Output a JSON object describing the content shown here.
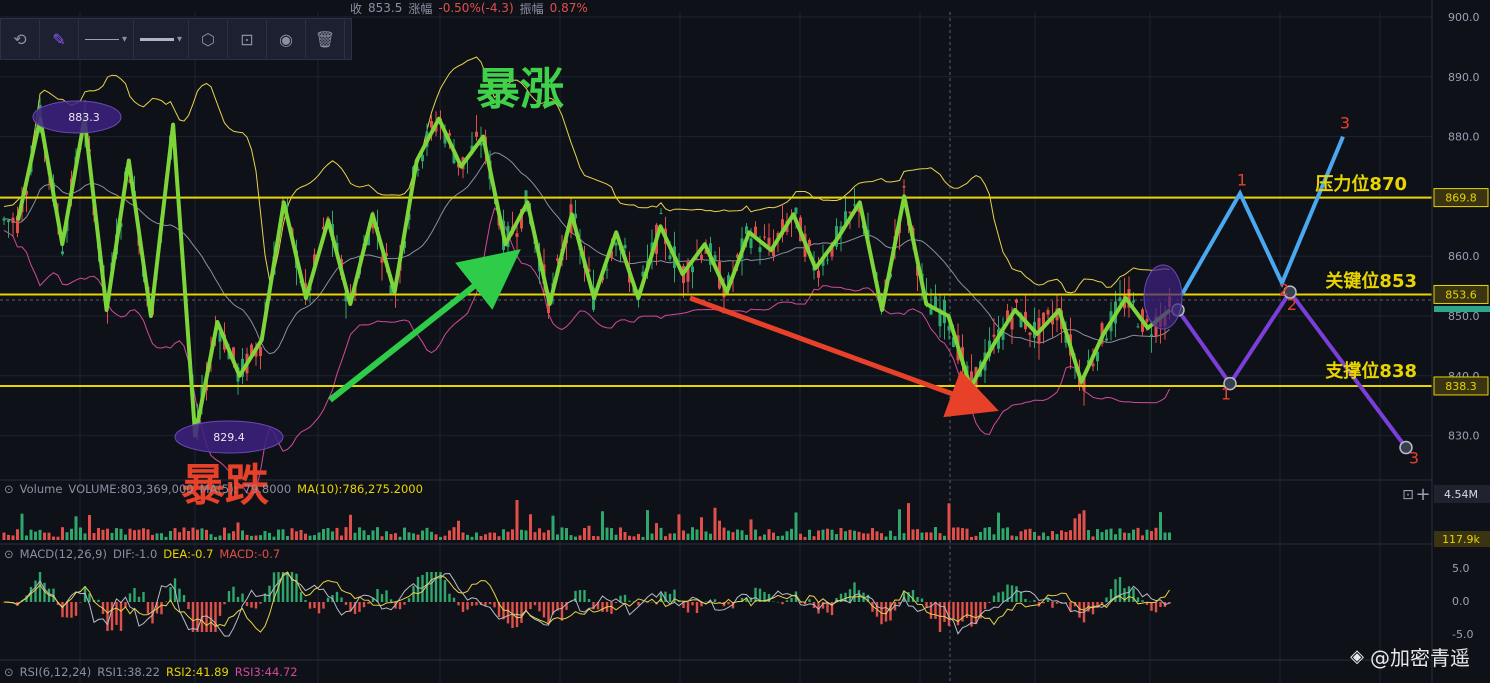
{
  "topbar": {
    "close_label": "收",
    "close_value": "853.5",
    "change_label": "涨幅",
    "change_value": "-0.50%(-4.3)",
    "amplitude_label": "振幅",
    "amplitude_value": "0.87%"
  },
  "toolbar": {
    "icons": [
      "lock-refresh-icon",
      "pen-icon",
      "line-style-icon",
      "line-width-icon",
      "settings-icon",
      "lock-icon",
      "eye-icon",
      "trash-icon"
    ]
  },
  "annotations": {
    "surge": "暴涨",
    "plunge": "暴跌",
    "high_label": "883.3",
    "low_label": "829.4",
    "resistance": "压力位870",
    "key_level": "关键位853",
    "support": "支撑位838"
  },
  "price_axis": {
    "ticks": [
      "900.0",
      "890.0",
      "880.0",
      "870.0",
      "860.0",
      "850.0",
      "840.0",
      "830.0"
    ],
    "tags": {
      "resistance": "869.8",
      "current": "853.6",
      "support": "838.3"
    }
  },
  "volume": {
    "label": "Volume",
    "indicator": "VOLUME:803,369,000",
    "ma5_text": "MA(5):",
    "ma5_tail": "79.8000",
    "ma10": "MA(10):786,275.2000",
    "axis_top": "4.54M",
    "axis_bottom": "117.9k"
  },
  "macd": {
    "label": "MACD(12,26,9)",
    "dif": "DIF:-1.0",
    "dea": "DEA:-0.7",
    "macd": "MACD:-0.7",
    "ticks": [
      "5.0",
      "0.0",
      "-5.0"
    ]
  },
  "rsi": {
    "label": "RSI(6,12,24)",
    "rsi1": "RSI1:38.22",
    "rsi2": "RSI2:41.89",
    "rsi3": "RSI3:44.72"
  },
  "scenario_labels": {
    "up": [
      "1",
      "2",
      "3"
    ],
    "down": [
      "1",
      "2",
      "3"
    ]
  },
  "watermark": "@加密青遥",
  "colors": {
    "background": "#0f1118",
    "level_line": "#e8d400",
    "trend_green": "#7dd53a",
    "arrow_green": "#2fcc4a",
    "arrow_red": "#e8412a",
    "up_path": "#4aa8f0",
    "down_path": "#7a3fd8",
    "candle_up": "#2ea66c",
    "candle_down": "#e0504a",
    "boll_upper": "#e6d24a",
    "boll_lower": "#d04a9a",
    "boll_mid": "#8a8fa0",
    "ellipse": "#4a2a8c"
  },
  "chart_data": {
    "type": "candlestick",
    "y_axis": {
      "min": 825,
      "max": 900,
      "ticks": [
        900,
        890,
        880,
        870,
        860,
        850,
        840,
        830
      ]
    },
    "levels": [
      {
        "name": "压力位870",
        "value": 869.8
      },
      {
        "name": "关键位853",
        "value": 853.6
      },
      {
        "name": "支撑位838",
        "value": 838.3
      }
    ],
    "extremes": {
      "high": 883.3,
      "low": 829.4
    },
    "zigzag": [
      866,
      883,
      862,
      883,
      851,
      876,
      850,
      882,
      830,
      849,
      840,
      846,
      869,
      853,
      866,
      852,
      867,
      854,
      876,
      883,
      875,
      880,
      862,
      869,
      852,
      867,
      853,
      864,
      853,
      865,
      857,
      862,
      854,
      864,
      861,
      867,
      858,
      863,
      869,
      851,
      870,
      852,
      850,
      838,
      845,
      851,
      847,
      851,
      839,
      847,
      853,
      848,
      851
    ],
    "scenario_up": [
      {
        "label": "1",
        "value": 870.5
      },
      {
        "label": "2",
        "value": 855.5
      },
      {
        "label": "3",
        "value": 880.0
      }
    ],
    "scenario_down": [
      {
        "label": "1",
        "value": 838.7
      },
      {
        "label": "2",
        "value": 854.0
      },
      {
        "label": "3",
        "value": 828.0
      }
    ]
  }
}
